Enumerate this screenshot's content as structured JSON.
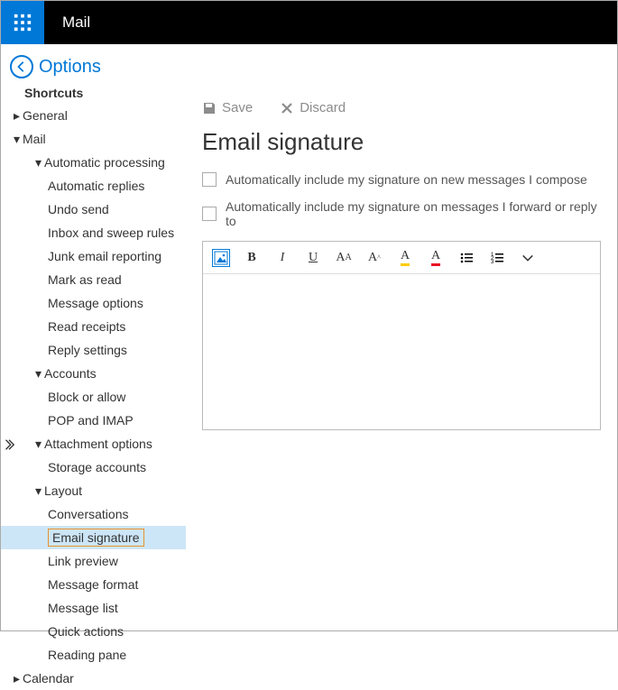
{
  "app": {
    "title": "Mail"
  },
  "options": {
    "title": "Options",
    "shortcuts": "Shortcuts"
  },
  "nav": {
    "general": "General",
    "mail": "Mail",
    "autoproc": "Automatic processing",
    "autoproc_items": {
      "auto_replies": "Automatic replies",
      "undo_send": "Undo send",
      "inbox_sweep": "Inbox and sweep rules",
      "junk": "Junk email reporting",
      "mark_read": "Mark as read",
      "msg_options": "Message options",
      "read_receipts": "Read receipts",
      "reply_settings": "Reply settings"
    },
    "accounts": "Accounts",
    "accounts_items": {
      "block": "Block or allow",
      "pop": "POP and IMAP"
    },
    "attach": "Attachment options",
    "attach_items": {
      "storage": "Storage accounts"
    },
    "layout": "Layout",
    "layout_items": {
      "conversations": "Conversations",
      "email_sig": "Email signature",
      "link_preview": "Link preview",
      "msg_format": "Message format",
      "msg_list": "Message list",
      "quick_actions": "Quick actions",
      "reading_pane": "Reading pane"
    },
    "calendar": "Calendar"
  },
  "toolbar": {
    "save": "Save",
    "discard": "Discard"
  },
  "page": {
    "heading": "Email signature",
    "check1": "Automatically include my signature on new messages I compose",
    "check2": "Automatically include my signature on messages I forward or reply to"
  },
  "editor_icons": {
    "image": "image-icon",
    "bold": "B",
    "italic": "I",
    "underline": "U",
    "fontsize": "A",
    "fontsize_small": "A",
    "sup": "A",
    "highlight": "A",
    "color": "A",
    "bullets": "bullets",
    "numbers": "numbers",
    "more": "more"
  }
}
